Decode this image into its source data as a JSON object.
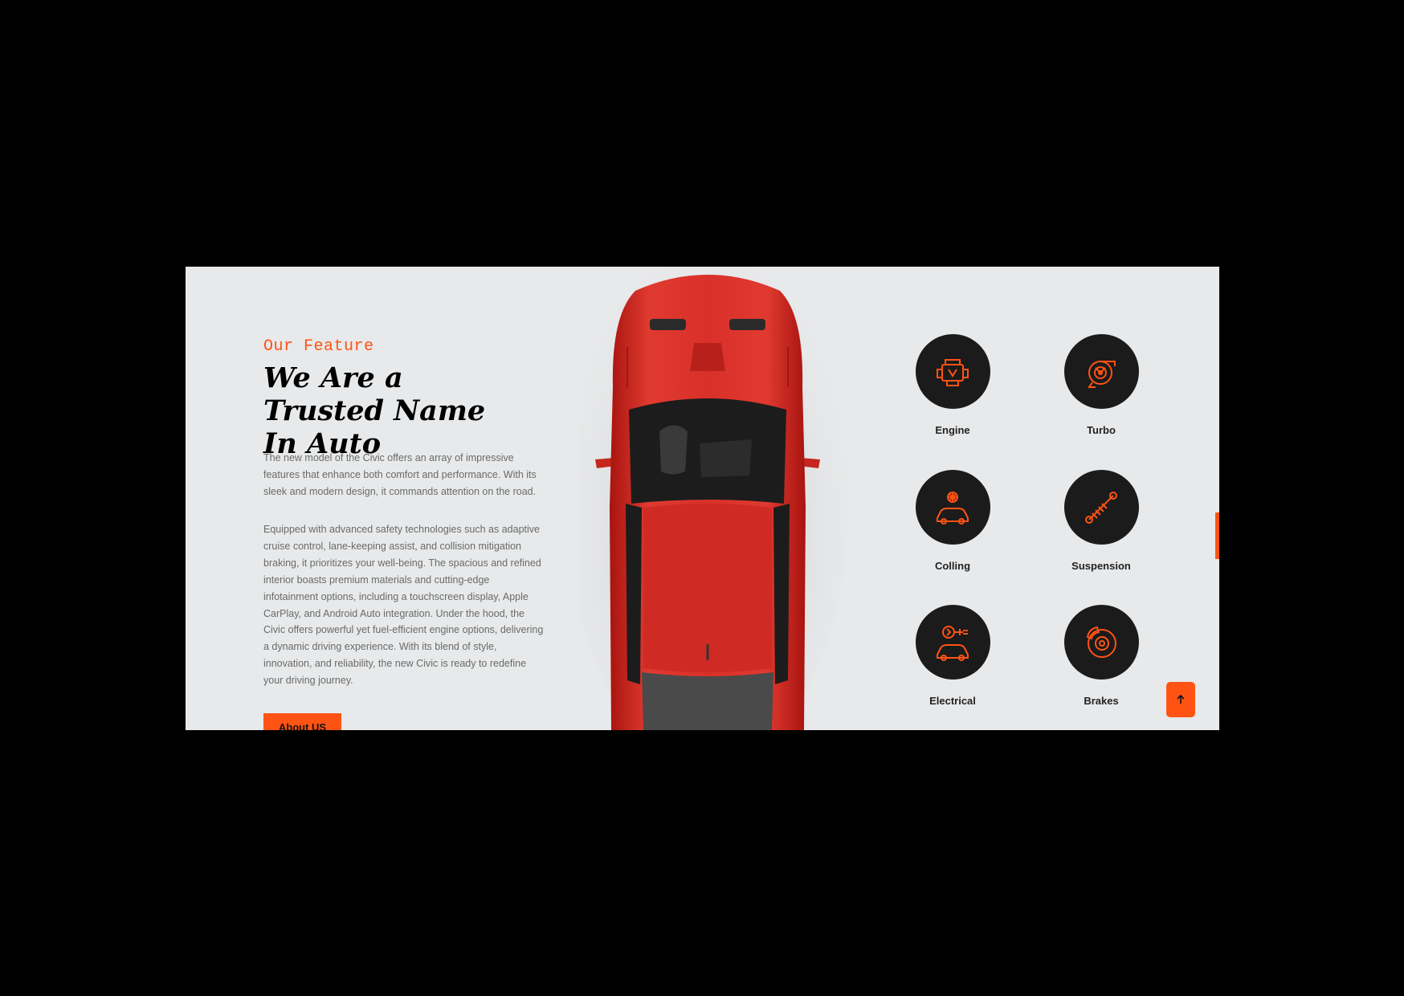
{
  "section": {
    "eyebrow": "Our Feature",
    "title": "We Are a Trusted Name In Auto",
    "paragraph_1": "The new model of the Civic offers an array of impressive features that enhance both comfort and performance. With its sleek and modern design, it commands attention on the road.",
    "paragraph_2": "Equipped with advanced safety technologies such as adaptive cruise control, lane-keeping assist, and collision mitigation braking, it prioritizes your well-being. The spacious and refined interior boasts premium materials and cutting-edge infotainment options, including a touchscreen display, Apple CarPlay, and Android Auto integration. Under the hood, the Civic offers powerful yet fuel-efficient engine options, delivering a dynamic driving experience. With its blend of style, innovation, and reliability, the new Civic is ready to redefine your driving journey.",
    "button_label": "About US"
  },
  "features": [
    {
      "label": "Engine",
      "icon": "engine-icon"
    },
    {
      "label": "Turbo",
      "icon": "turbo-icon"
    },
    {
      "label": "Colling",
      "icon": "cooling-icon"
    },
    {
      "label": "Suspension",
      "icon": "suspension-icon"
    },
    {
      "label": "Electrical",
      "icon": "electrical-icon"
    },
    {
      "label": "Brakes",
      "icon": "brakes-icon"
    }
  ],
  "colors": {
    "accent": "#ff5314",
    "panel_background": "#e8e9ea",
    "icon_circle": "#1b1b1b",
    "car": "#d42a24"
  },
  "scroll_top_icon": "arrow-up-icon"
}
